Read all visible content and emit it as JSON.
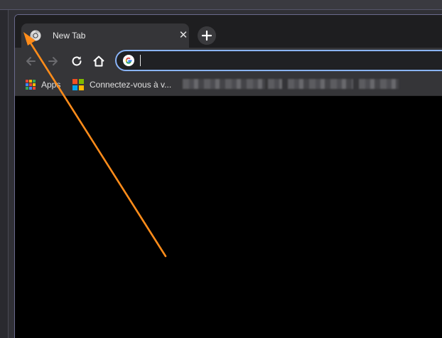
{
  "tab": {
    "title": "New Tab",
    "close_glyph": "✕",
    "favicon": "chrome-icon"
  },
  "toolbar": {
    "back_icon": "arrow-left-icon",
    "forward_icon": "arrow-right-icon",
    "reload_icon": "reload-icon",
    "home_icon": "home-icon",
    "new_tab_glyph": "+"
  },
  "omnibox": {
    "value": "",
    "icon": "google-g-icon",
    "focus_color": "#8ab4f8"
  },
  "bookmarks": [
    {
      "label": "Apps",
      "icon": "apps-grid-icon"
    },
    {
      "label": "Connectez-vous à v...",
      "icon": "microsoft-logo-icon"
    }
  ],
  "colors": {
    "tab_strip": "#1e1e20",
    "toolbar": "#353538",
    "content": "#000000",
    "annotation_arrow": "#ff8c1a"
  }
}
